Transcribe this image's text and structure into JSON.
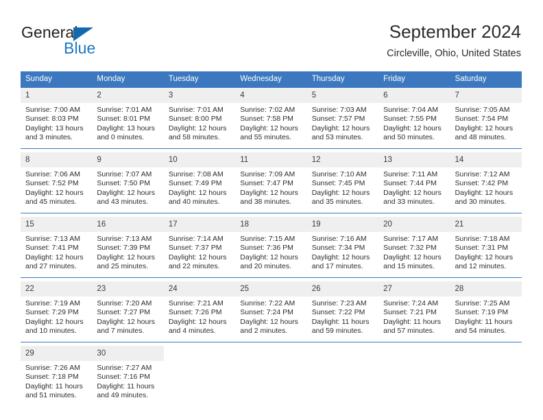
{
  "brand": {
    "name_part1": "General",
    "name_part2": "Blue",
    "triangle_color": "#1468b0",
    "blue_color": "#1b76c4"
  },
  "header": {
    "title": "September 2024",
    "subtitle": "Circleville, Ohio, United States"
  },
  "theme": {
    "header_bg": "#3c78bf",
    "daynum_bg": "#efefef",
    "separator": "#3c78bf",
    "text": "#2c2c2c"
  },
  "weekday_headers": [
    "Sunday",
    "Monday",
    "Tuesday",
    "Wednesday",
    "Thursday",
    "Friday",
    "Saturday"
  ],
  "weeks": [
    [
      {
        "day": "1",
        "sunrise": "Sunrise: 7:00 AM",
        "sunset": "Sunset: 8:03 PM",
        "daylight1": "Daylight: 13 hours",
        "daylight2": "and 3 minutes."
      },
      {
        "day": "2",
        "sunrise": "Sunrise: 7:01 AM",
        "sunset": "Sunset: 8:01 PM",
        "daylight1": "Daylight: 13 hours",
        "daylight2": "and 0 minutes."
      },
      {
        "day": "3",
        "sunrise": "Sunrise: 7:01 AM",
        "sunset": "Sunset: 8:00 PM",
        "daylight1": "Daylight: 12 hours",
        "daylight2": "and 58 minutes."
      },
      {
        "day": "4",
        "sunrise": "Sunrise: 7:02 AM",
        "sunset": "Sunset: 7:58 PM",
        "daylight1": "Daylight: 12 hours",
        "daylight2": "and 55 minutes."
      },
      {
        "day": "5",
        "sunrise": "Sunrise: 7:03 AM",
        "sunset": "Sunset: 7:57 PM",
        "daylight1": "Daylight: 12 hours",
        "daylight2": "and 53 minutes."
      },
      {
        "day": "6",
        "sunrise": "Sunrise: 7:04 AM",
        "sunset": "Sunset: 7:55 PM",
        "daylight1": "Daylight: 12 hours",
        "daylight2": "and 50 minutes."
      },
      {
        "day": "7",
        "sunrise": "Sunrise: 7:05 AM",
        "sunset": "Sunset: 7:54 PM",
        "daylight1": "Daylight: 12 hours",
        "daylight2": "and 48 minutes."
      }
    ],
    [
      {
        "day": "8",
        "sunrise": "Sunrise: 7:06 AM",
        "sunset": "Sunset: 7:52 PM",
        "daylight1": "Daylight: 12 hours",
        "daylight2": "and 45 minutes."
      },
      {
        "day": "9",
        "sunrise": "Sunrise: 7:07 AM",
        "sunset": "Sunset: 7:50 PM",
        "daylight1": "Daylight: 12 hours",
        "daylight2": "and 43 minutes."
      },
      {
        "day": "10",
        "sunrise": "Sunrise: 7:08 AM",
        "sunset": "Sunset: 7:49 PM",
        "daylight1": "Daylight: 12 hours",
        "daylight2": "and 40 minutes."
      },
      {
        "day": "11",
        "sunrise": "Sunrise: 7:09 AM",
        "sunset": "Sunset: 7:47 PM",
        "daylight1": "Daylight: 12 hours",
        "daylight2": "and 38 minutes."
      },
      {
        "day": "12",
        "sunrise": "Sunrise: 7:10 AM",
        "sunset": "Sunset: 7:45 PM",
        "daylight1": "Daylight: 12 hours",
        "daylight2": "and 35 minutes."
      },
      {
        "day": "13",
        "sunrise": "Sunrise: 7:11 AM",
        "sunset": "Sunset: 7:44 PM",
        "daylight1": "Daylight: 12 hours",
        "daylight2": "and 33 minutes."
      },
      {
        "day": "14",
        "sunrise": "Sunrise: 7:12 AM",
        "sunset": "Sunset: 7:42 PM",
        "daylight1": "Daylight: 12 hours",
        "daylight2": "and 30 minutes."
      }
    ],
    [
      {
        "day": "15",
        "sunrise": "Sunrise: 7:13 AM",
        "sunset": "Sunset: 7:41 PM",
        "daylight1": "Daylight: 12 hours",
        "daylight2": "and 27 minutes."
      },
      {
        "day": "16",
        "sunrise": "Sunrise: 7:13 AM",
        "sunset": "Sunset: 7:39 PM",
        "daylight1": "Daylight: 12 hours",
        "daylight2": "and 25 minutes."
      },
      {
        "day": "17",
        "sunrise": "Sunrise: 7:14 AM",
        "sunset": "Sunset: 7:37 PM",
        "daylight1": "Daylight: 12 hours",
        "daylight2": "and 22 minutes."
      },
      {
        "day": "18",
        "sunrise": "Sunrise: 7:15 AM",
        "sunset": "Sunset: 7:36 PM",
        "daylight1": "Daylight: 12 hours",
        "daylight2": "and 20 minutes."
      },
      {
        "day": "19",
        "sunrise": "Sunrise: 7:16 AM",
        "sunset": "Sunset: 7:34 PM",
        "daylight1": "Daylight: 12 hours",
        "daylight2": "and 17 minutes."
      },
      {
        "day": "20",
        "sunrise": "Sunrise: 7:17 AM",
        "sunset": "Sunset: 7:32 PM",
        "daylight1": "Daylight: 12 hours",
        "daylight2": "and 15 minutes."
      },
      {
        "day": "21",
        "sunrise": "Sunrise: 7:18 AM",
        "sunset": "Sunset: 7:31 PM",
        "daylight1": "Daylight: 12 hours",
        "daylight2": "and 12 minutes."
      }
    ],
    [
      {
        "day": "22",
        "sunrise": "Sunrise: 7:19 AM",
        "sunset": "Sunset: 7:29 PM",
        "daylight1": "Daylight: 12 hours",
        "daylight2": "and 10 minutes."
      },
      {
        "day": "23",
        "sunrise": "Sunrise: 7:20 AM",
        "sunset": "Sunset: 7:27 PM",
        "daylight1": "Daylight: 12 hours",
        "daylight2": "and 7 minutes."
      },
      {
        "day": "24",
        "sunrise": "Sunrise: 7:21 AM",
        "sunset": "Sunset: 7:26 PM",
        "daylight1": "Daylight: 12 hours",
        "daylight2": "and 4 minutes."
      },
      {
        "day": "25",
        "sunrise": "Sunrise: 7:22 AM",
        "sunset": "Sunset: 7:24 PM",
        "daylight1": "Daylight: 12 hours",
        "daylight2": "and 2 minutes."
      },
      {
        "day": "26",
        "sunrise": "Sunrise: 7:23 AM",
        "sunset": "Sunset: 7:22 PM",
        "daylight1": "Daylight: 11 hours",
        "daylight2": "and 59 minutes."
      },
      {
        "day": "27",
        "sunrise": "Sunrise: 7:24 AM",
        "sunset": "Sunset: 7:21 PM",
        "daylight1": "Daylight: 11 hours",
        "daylight2": "and 57 minutes."
      },
      {
        "day": "28",
        "sunrise": "Sunrise: 7:25 AM",
        "sunset": "Sunset: 7:19 PM",
        "daylight1": "Daylight: 11 hours",
        "daylight2": "and 54 minutes."
      }
    ],
    [
      {
        "day": "29",
        "sunrise": "Sunrise: 7:26 AM",
        "sunset": "Sunset: 7:18 PM",
        "daylight1": "Daylight: 11 hours",
        "daylight2": "and 51 minutes."
      },
      {
        "day": "30",
        "sunrise": "Sunrise: 7:27 AM",
        "sunset": "Sunset: 7:16 PM",
        "daylight1": "Daylight: 11 hours",
        "daylight2": "and 49 minutes."
      },
      {
        "day": "",
        "sunrise": "",
        "sunset": "",
        "daylight1": "",
        "daylight2": ""
      },
      {
        "day": "",
        "sunrise": "",
        "sunset": "",
        "daylight1": "",
        "daylight2": ""
      },
      {
        "day": "",
        "sunrise": "",
        "sunset": "",
        "daylight1": "",
        "daylight2": ""
      },
      {
        "day": "",
        "sunrise": "",
        "sunset": "",
        "daylight1": "",
        "daylight2": ""
      },
      {
        "day": "",
        "sunrise": "",
        "sunset": "",
        "daylight1": "",
        "daylight2": ""
      }
    ]
  ]
}
